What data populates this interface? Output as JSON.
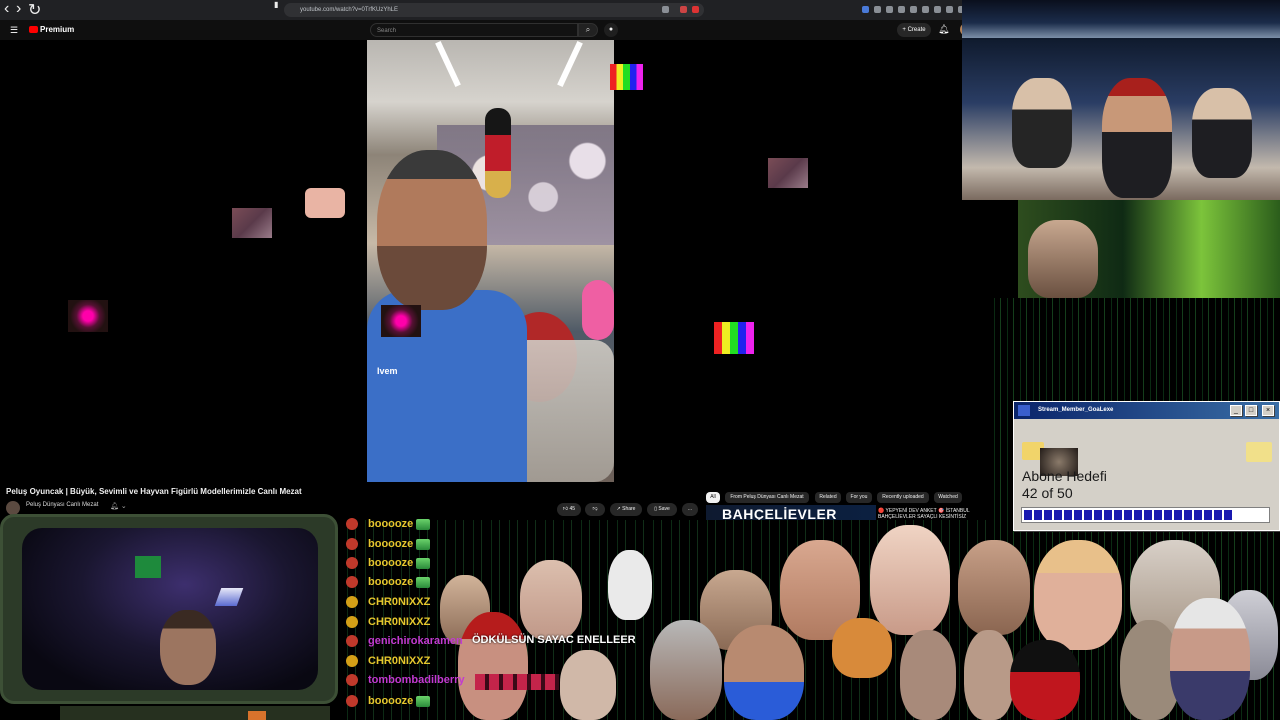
{
  "browser": {
    "url": "youtube.com/watch?v=0TrfKUzYhLE"
  },
  "header": {
    "logo_text": "Premium",
    "search_placeholder": "Search",
    "create_label": "+ Create"
  },
  "video": {
    "title": "Peluş Oyuncak | Büyük, Sevimli ve Hayvan Figürlü Modellerimizle Canlı Mezat",
    "channel": "Peluş Dünyası Canlı Mezat",
    "shirt_text": "Ivem",
    "likes": "45",
    "share_label": "Share",
    "save_label": "Save",
    "more_label": "..."
  },
  "chips": [
    "All",
    "From Peluş Dünyası Canlı Mezat",
    "Related",
    "For you",
    "Recently uploaded",
    "Watched"
  ],
  "recommendation": {
    "thumb_text": "BAHÇELİEVLER",
    "title": "🔴 YEPYENİ DEV ANKET 🎯 İSTANBUL BAHÇELİEVLER SAYAÇLI KESİNTİSİZ"
  },
  "dialog": {
    "title": "Stream_Member_GoaLexe",
    "label": "Abone Hedefi",
    "count": "42 of 50",
    "progress": 0.84
  },
  "chat": [
    {
      "user": "booooze",
      "color": "#e6c72e",
      "badge": "#c0392b"
    },
    {
      "user": "booooze",
      "color": "#e6c72e",
      "badge": "#c0392b"
    },
    {
      "user": "booooze",
      "color": "#e6c72e",
      "badge": "#c0392b"
    },
    {
      "user": "booooze",
      "color": "#e6c72e",
      "badge": "#c0392b"
    },
    {
      "user": "CHR0NIXXZ",
      "color": "#e6c72e",
      "badge": "#d4a017"
    },
    {
      "user": "CHR0NIXXZ",
      "color": "#e6c72e",
      "badge": "#d4a017"
    },
    {
      "user": "genichirokaramen",
      "color": "#c23ad1",
      "badge": "#c0392b"
    },
    {
      "user": "CHR0NIXXZ",
      "color": "#e6c72e",
      "badge": "#d4a017"
    },
    {
      "user": "tombombadilberry",
      "color": "#c23ad1",
      "badge": "#c0392b"
    },
    {
      "user": "booooze",
      "color": "#e6c72e",
      "badge": "#c0392b"
    }
  ],
  "chat_messages": {
    "msg1": "ÖDKÜLSÜN SAYAC ENELLEER"
  }
}
